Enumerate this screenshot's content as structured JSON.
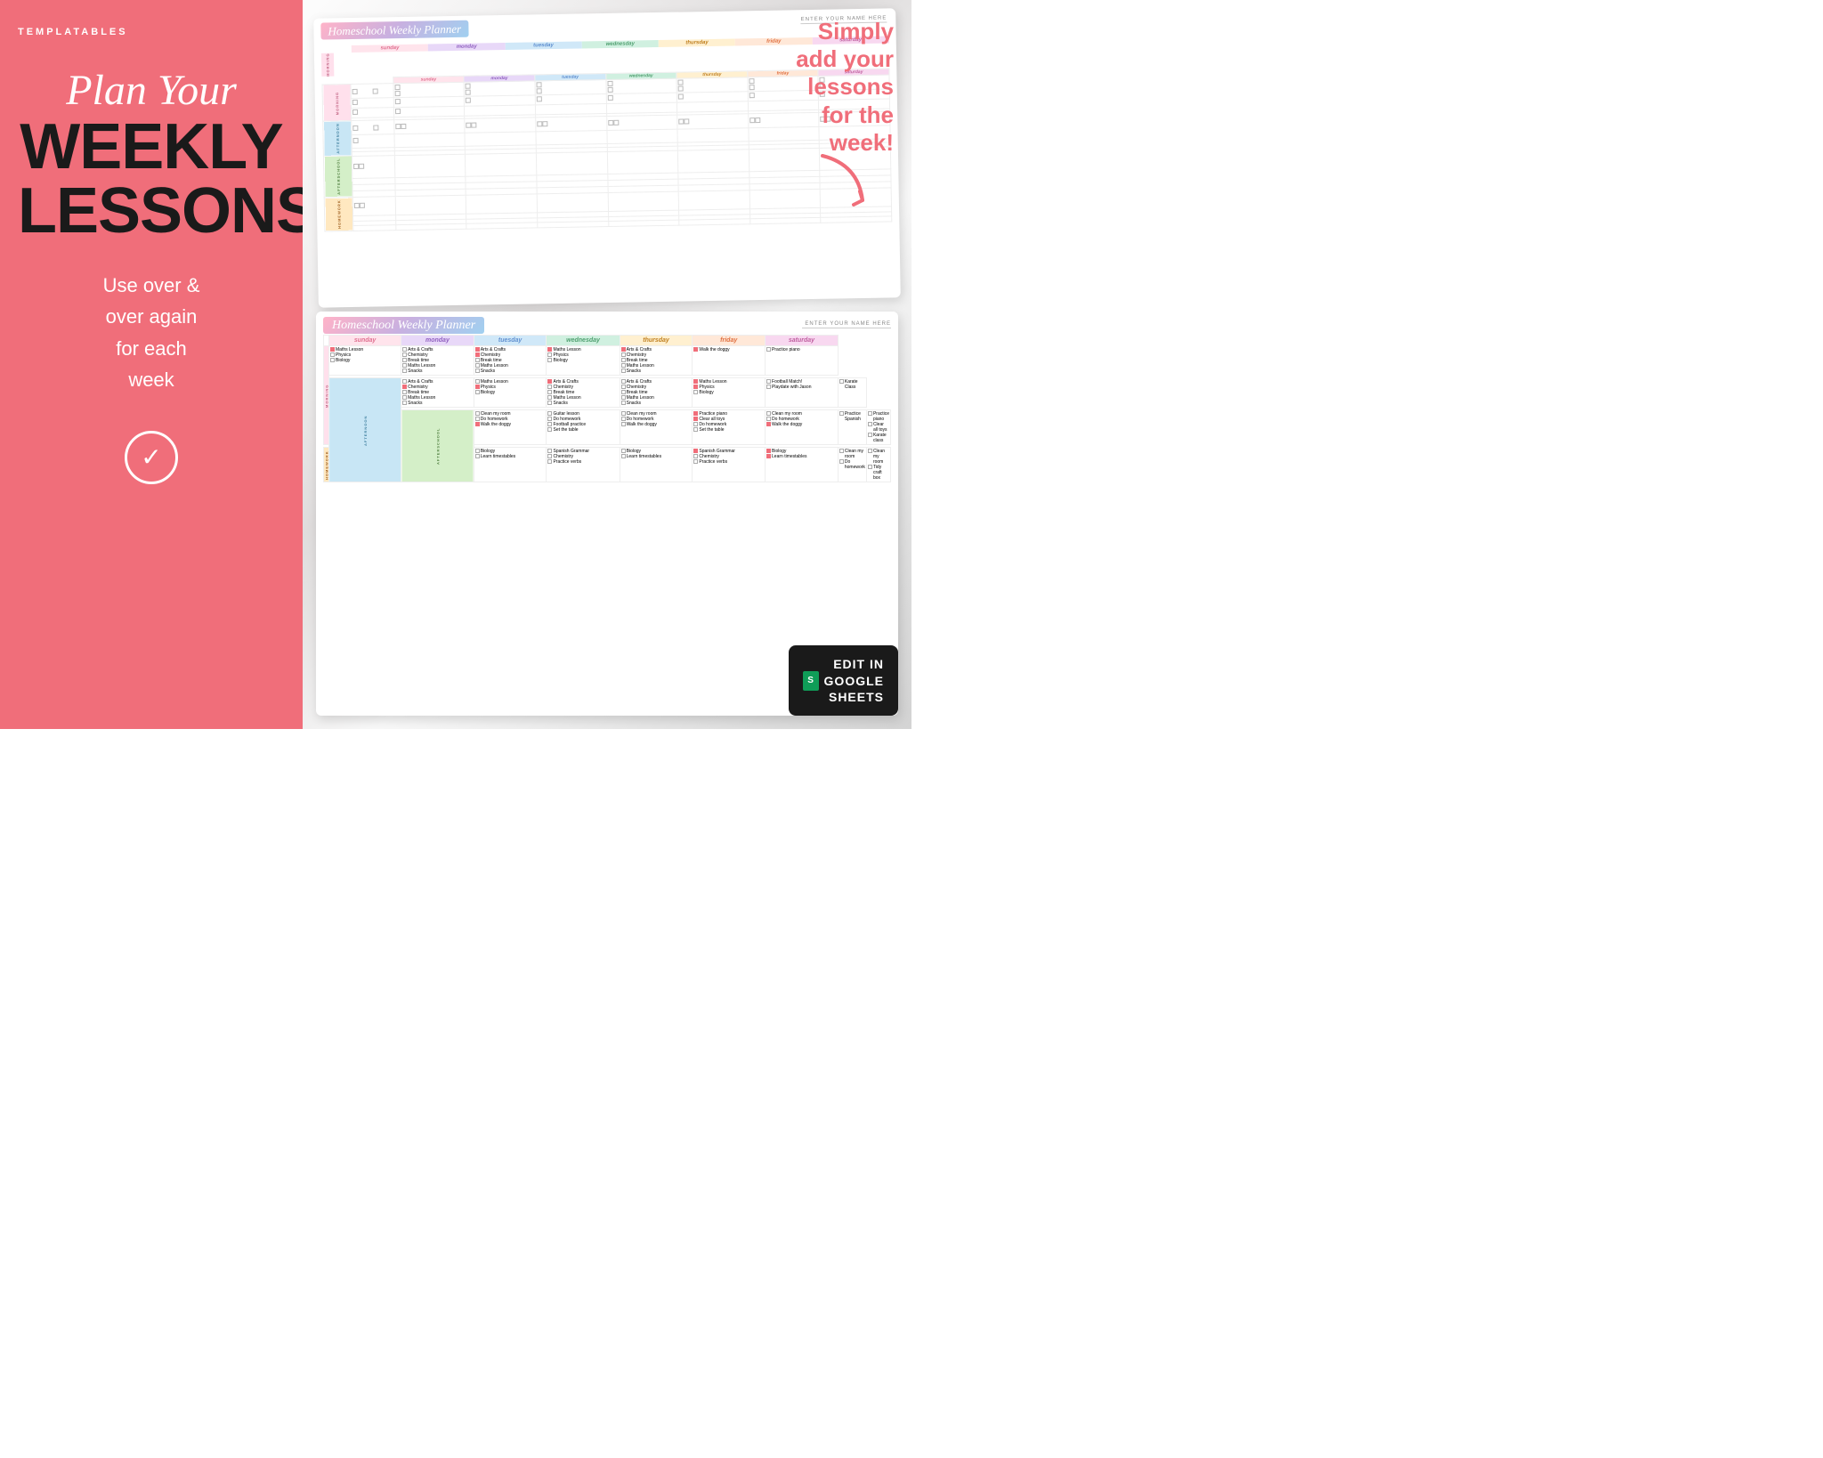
{
  "brand": "TEMPLATABLES",
  "left": {
    "plan_your": "Plan Your",
    "weekly": "WEEKLY",
    "lessons": "LESSONS",
    "use_over": "Use over &\nover again\nfor each\nweek"
  },
  "right": {
    "simply_text": "Simply\nadd your\nlessons\nfor the\nweek!",
    "card1": {
      "title": "Homeschool Weekly Planner",
      "name_placeholder": "ENTER YOUR NAME HERE"
    },
    "card2": {
      "title": "Homeschool Weekly Planner",
      "name_placeholder": "ENTER YOUR NAME HERE",
      "days": [
        "sunday",
        "monday",
        "tuesday",
        "wednesday",
        "thursday",
        "friday",
        "saturday"
      ],
      "sections": [
        "MORNING",
        "AFTERNOON",
        "AFTERSCHOOL",
        "HOMEWORK"
      ],
      "data": {
        "morning": {
          "sunday": [
            "Maths Lesson",
            "Physics",
            "Biology"
          ],
          "monday": [
            "Arts & Crafts",
            "Chemistry",
            "Break time",
            "Maths Lesson",
            "Snacks"
          ],
          "tuesday": [
            "Arts & Crafts",
            "Chemistry",
            "Break time",
            "Maths Lesson",
            "Snacks"
          ],
          "wednesday": [
            "Maths Lesson",
            "Physics",
            "Biology"
          ],
          "thursday": [
            "Arts & Crafts",
            "Chemistry",
            "Break time",
            "Maths Lesson",
            "Snacks"
          ],
          "friday": [
            "Walk the doggy"
          ],
          "saturday": [
            "Practice piano"
          ]
        },
        "afternoon": {
          "sunday": [
            "Arts & Crafts",
            "Chemistry",
            "Break time",
            "Maths Lesson",
            "Snacks"
          ],
          "monday": [
            "Maths Lesson",
            "Physics",
            "Biology"
          ],
          "tuesday": [
            "Arts & Crafts",
            "Chemistry",
            "Break time",
            "Maths Lesson",
            "Snacks"
          ],
          "wednesday": [
            "Arts & Crafts",
            "Chemistry",
            "Break time",
            "Maths Lesson",
            "Snacks"
          ],
          "thursday": [
            "Maths Lesson",
            "Physics",
            "Biology"
          ],
          "friday": [
            "Football Match!",
            "Playdate with Jason"
          ],
          "saturday": [
            "Karate Class"
          ]
        },
        "afterschool": {
          "sunday": [
            "Clean my room",
            "Do homework",
            "Walk the doggy"
          ],
          "monday": [
            "Guitar lesson",
            "Do homework",
            "Football practice",
            "Set the table"
          ],
          "tuesday": [
            "Clean my room",
            "Do homework",
            "Walk the doggy"
          ],
          "wednesday": [
            "Practice piano",
            "Clear all toys",
            "Do homework",
            "Set the table"
          ],
          "thursday": [
            "Clean my room",
            "Do homework",
            "Walk the doggy"
          ],
          "friday": [
            "Practice Spanish"
          ],
          "saturday": [
            "Practice piano",
            "Clear all toys",
            "Karate class"
          ]
        },
        "homework": {
          "sunday": [
            "Biology",
            "Learn timestables"
          ],
          "monday": [
            "Spanish Grammar",
            "Chemistry",
            "Practice verbs"
          ],
          "tuesday": [
            "Biology",
            "Learn timestables"
          ],
          "wednesday": [
            "Spanish Grammar",
            "Chemistry",
            "Practice verbs"
          ],
          "thursday": [
            "Biology",
            "Learn timestables"
          ],
          "friday": [
            "Clean my room",
            "Do homework"
          ],
          "saturday": [
            "Clean my room",
            "Tidy craft box"
          ]
        }
      }
    },
    "edit_badge": {
      "line1": "EDIT IN",
      "line2": "GOOGLE",
      "line3": "SHEETS"
    }
  }
}
